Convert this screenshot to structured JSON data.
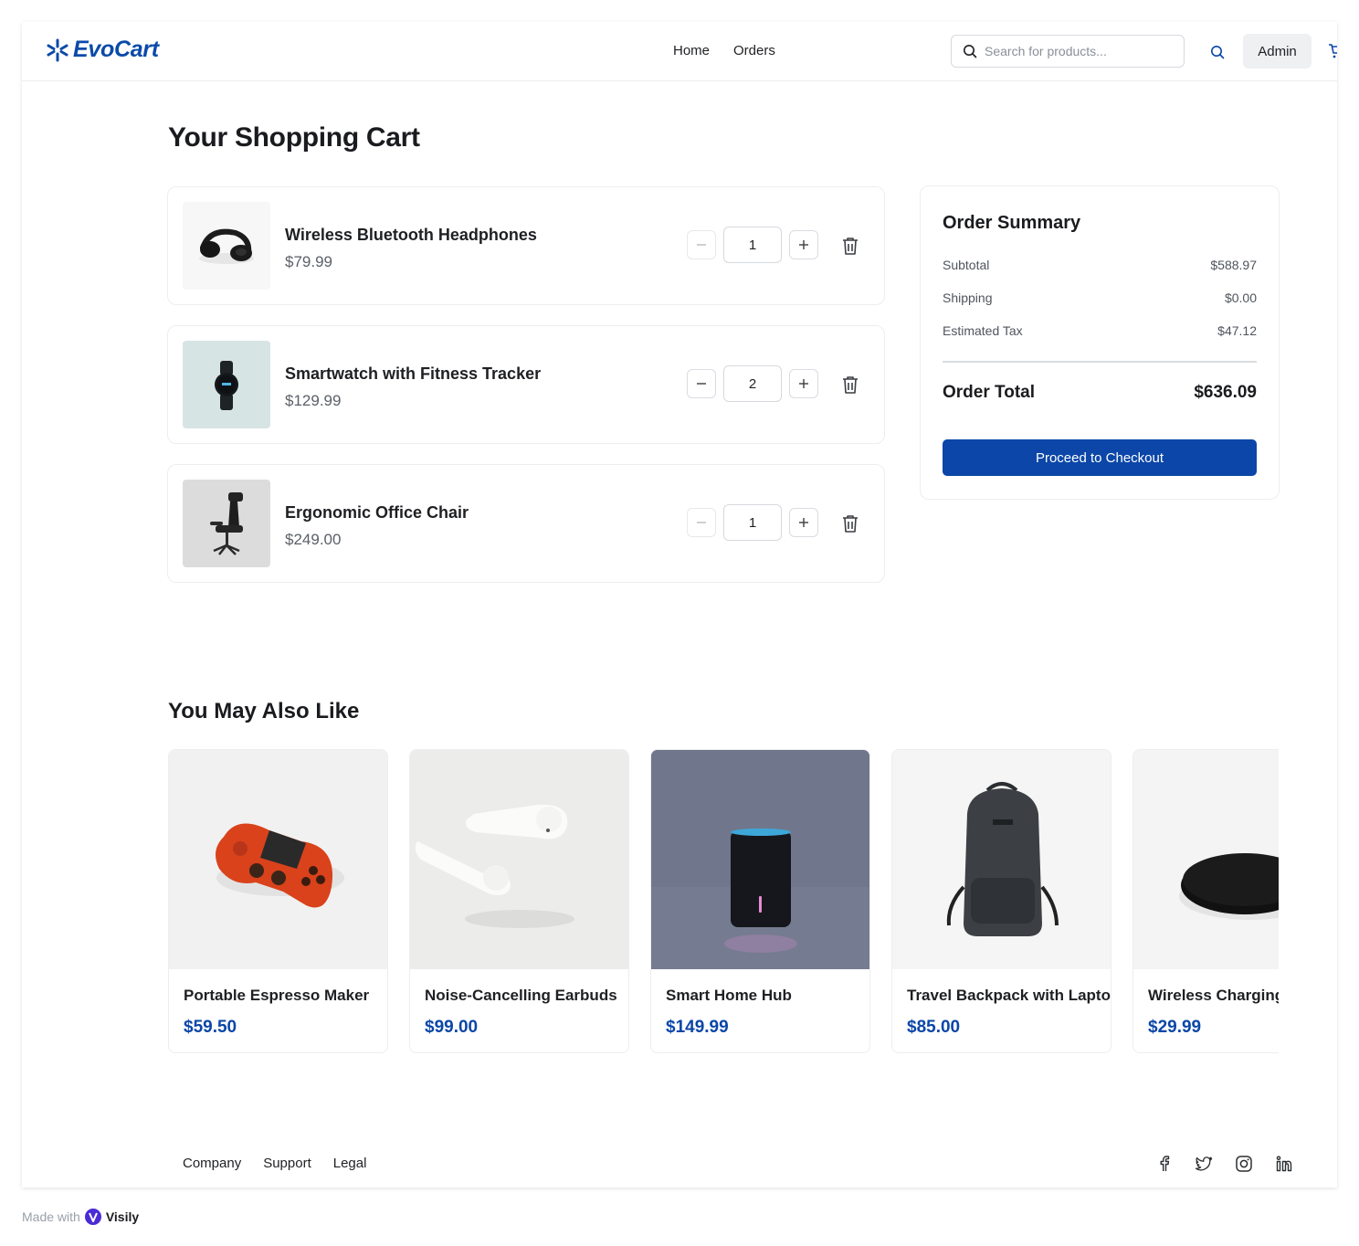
{
  "brand": {
    "name": "EvoCart",
    "accent": "#0b46a8"
  },
  "nav": {
    "home": "Home",
    "orders": "Orders"
  },
  "search": {
    "placeholder": "Search for products..."
  },
  "header": {
    "admin_label": "Admin",
    "icons": [
      "search-icon",
      "cart-icon"
    ]
  },
  "page_title": "Your Shopping Cart",
  "cart": {
    "items": [
      {
        "name": "Wireless Bluetooth Headphones",
        "price": "$79.99",
        "qty": "1",
        "image": "headphones-image"
      },
      {
        "name": "Smartwatch with Fitness Tracker",
        "price": "$129.99",
        "qty": "2",
        "image": "smartwatch-image"
      },
      {
        "name": "Ergonomic Office Chair",
        "price": "$249.00",
        "qty": "1",
        "image": "office-chair-image"
      }
    ]
  },
  "summary": {
    "title": "Order Summary",
    "subtotal_label": "Subtotal",
    "subtotal": "$588.97",
    "shipping_label": "Shipping",
    "shipping": "$0.00",
    "tax_label": "Estimated Tax",
    "tax": "$47.12",
    "total_label": "Order Total",
    "total": "$636.09",
    "checkout_label": "Proceed to Checkout"
  },
  "recommendations": {
    "title": "You May Also Like",
    "items": [
      {
        "name": "Portable Espresso Maker",
        "price": "$59.50",
        "image": "game-controller-image"
      },
      {
        "name": "Noise-Cancelling Earbuds",
        "price": "$99.00",
        "image": "earbuds-image"
      },
      {
        "name": "Smart Home Hub",
        "price": "$149.99",
        "image": "smart-speaker-image"
      },
      {
        "name": "Travel Backpack with Laptop Sleeve",
        "price": "$85.00",
        "image": "backpack-image"
      },
      {
        "name": "Wireless Charging Pad",
        "price": "$29.99",
        "image": "charging-pad-image"
      }
    ]
  },
  "footer": {
    "links": [
      "Company",
      "Support",
      "Legal"
    ],
    "social_icons": [
      "facebook-icon",
      "twitter-icon",
      "instagram-icon",
      "linkedin-icon"
    ]
  },
  "watermark": {
    "prefix": "Made with",
    "brand": "Visily"
  }
}
